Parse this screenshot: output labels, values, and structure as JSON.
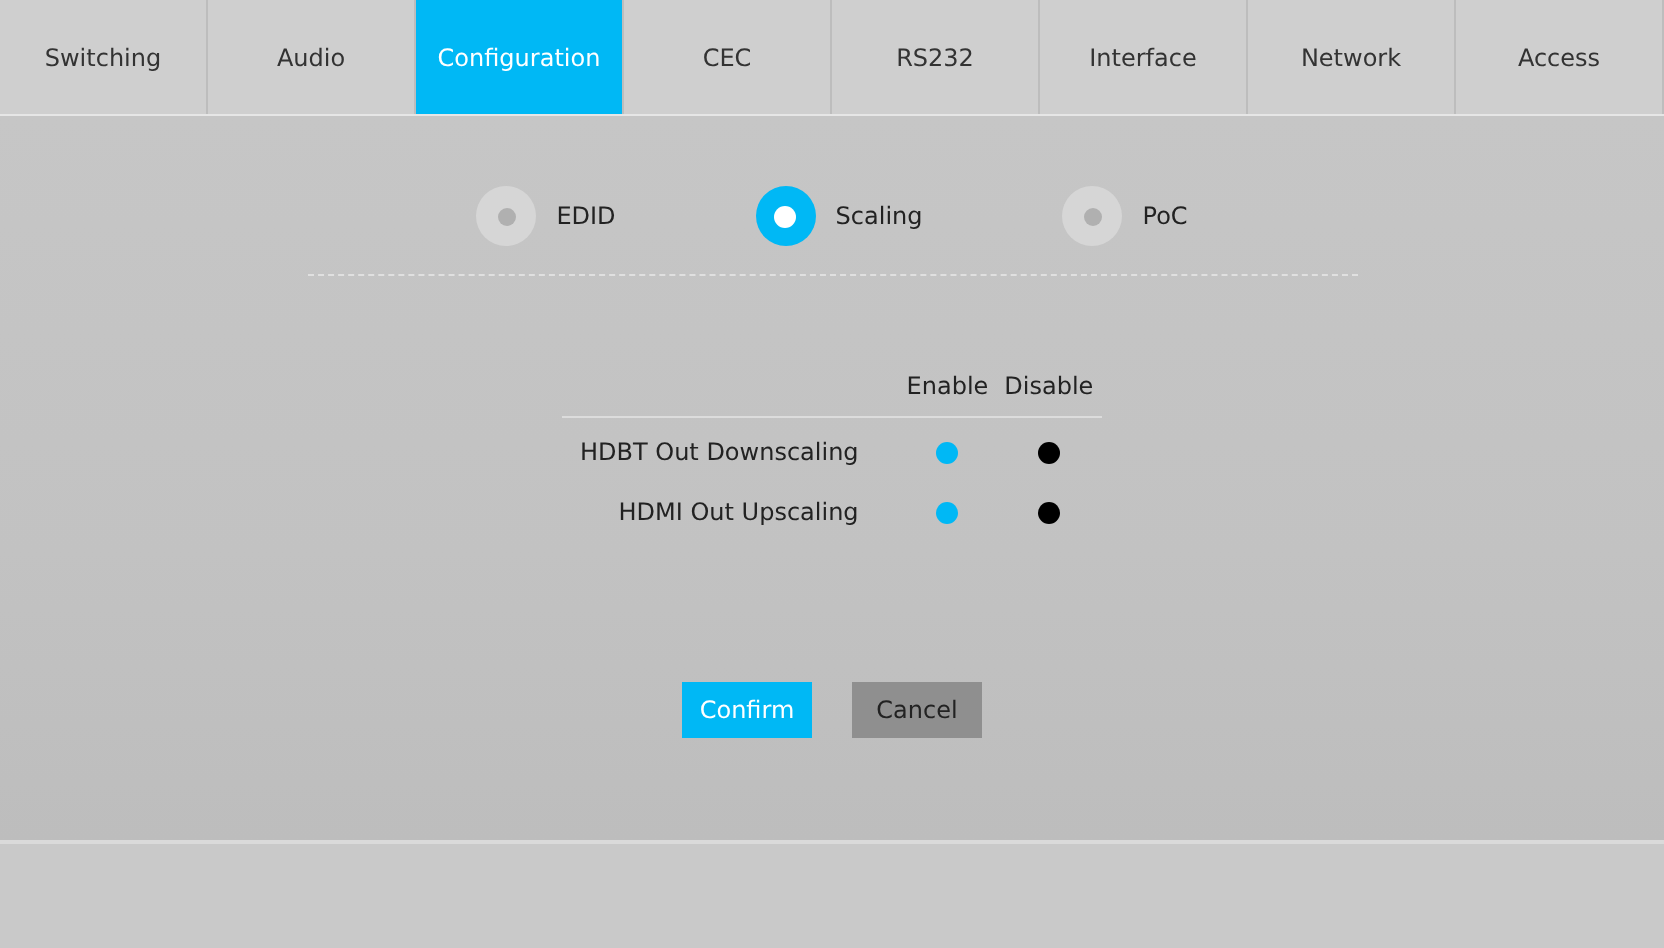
{
  "tabs": [
    {
      "label": "Switching",
      "selected": false
    },
    {
      "label": "Audio",
      "selected": false
    },
    {
      "label": "Configuration",
      "selected": true
    },
    {
      "label": "CEC",
      "selected": false
    },
    {
      "label": "RS232",
      "selected": false
    },
    {
      "label": "Interface",
      "selected": false
    },
    {
      "label": "Network",
      "selected": false
    },
    {
      "label": "Access",
      "selected": false
    }
  ],
  "modes": [
    {
      "label": "EDID",
      "selected": false
    },
    {
      "label": "Scaling",
      "selected": true
    },
    {
      "label": "PoC",
      "selected": false
    }
  ],
  "table": {
    "columns": [
      "Enable",
      "Disable"
    ],
    "rows": [
      {
        "label": "HDBT Out Downscaling",
        "options": [
          {
            "selected": true
          },
          {
            "selected": false
          }
        ]
      },
      {
        "label": "HDMI Out Upscaling",
        "options": [
          {
            "selected": true
          },
          {
            "selected": false
          }
        ]
      }
    ]
  },
  "buttons": [
    {
      "label": "Confirm",
      "kind": "primary"
    },
    {
      "label": "Cancel",
      "kind": "secondary"
    }
  ]
}
